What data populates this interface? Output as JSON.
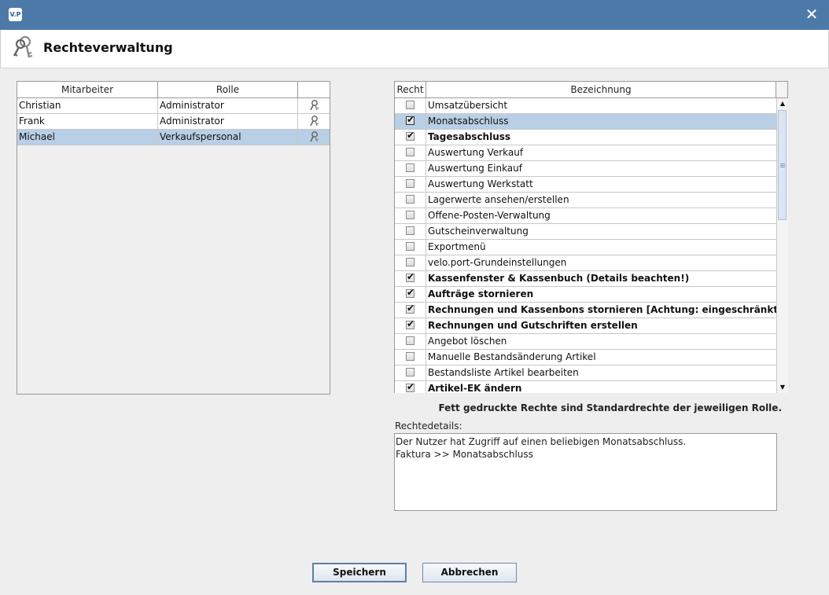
{
  "window": {
    "logo_text": "V.P",
    "close_glyph": "✕",
    "title": "Rechteverwaltung",
    "title_icon": "keys-icon"
  },
  "employees": {
    "columns": [
      "Mitarbeiter",
      "Rolle",
      ""
    ],
    "rows": [
      {
        "name": "Christian",
        "role": "Administrator",
        "action_icon": "edit-role-icon",
        "selected": false
      },
      {
        "name": "Frank",
        "role": "Administrator",
        "action_icon": "edit-role-icon",
        "selected": false
      },
      {
        "name": "Michael",
        "role": "Verkaufspersonal",
        "action_icon": "edit-role-icon",
        "selected": true
      }
    ]
  },
  "rights": {
    "columns": [
      "Recht",
      "Bezeichnung"
    ],
    "check_glyph": "✔",
    "rows": [
      {
        "label": "Umsatzübersicht",
        "checked": false,
        "bold": false,
        "selected": false
      },
      {
        "label": "Monatsabschluss",
        "checked": true,
        "bold": false,
        "selected": true
      },
      {
        "label": "Tagesabschluss",
        "checked": true,
        "bold": true,
        "selected": false
      },
      {
        "label": "Auswertung Verkauf",
        "checked": false,
        "bold": false,
        "selected": false
      },
      {
        "label": "Auswertung Einkauf",
        "checked": false,
        "bold": false,
        "selected": false
      },
      {
        "label": "Auswertung Werkstatt",
        "checked": false,
        "bold": false,
        "selected": false
      },
      {
        "label": "Lagerwerte ansehen/erstellen",
        "checked": false,
        "bold": false,
        "selected": false
      },
      {
        "label": "Offene-Posten-Verwaltung",
        "checked": false,
        "bold": false,
        "selected": false
      },
      {
        "label": "Gutscheinverwaltung",
        "checked": false,
        "bold": false,
        "selected": false
      },
      {
        "label": "Exportmenü",
        "checked": false,
        "bold": false,
        "selected": false
      },
      {
        "label": "velo.port-Grundeinstellungen",
        "checked": false,
        "bold": false,
        "selected": false
      },
      {
        "label": "Kassenfenster & Kassenbuch (Details beachten!)",
        "checked": true,
        "bold": true,
        "selected": false
      },
      {
        "label": "Aufträge stornieren",
        "checked": true,
        "bold": true,
        "selected": false
      },
      {
        "label": "Rechnungen und Kassenbons stornieren [Achtung: eingeschränkt]",
        "checked": true,
        "bold": true,
        "selected": false
      },
      {
        "label": "Rechnungen und Gutschriften erstellen",
        "checked": true,
        "bold": true,
        "selected": false
      },
      {
        "label": "Angebot löschen",
        "checked": false,
        "bold": false,
        "selected": false
      },
      {
        "label": "Manuelle Bestandsänderung Artikel",
        "checked": false,
        "bold": false,
        "selected": false
      },
      {
        "label": "Bestandsliste Artikel bearbeiten",
        "checked": false,
        "bold": false,
        "selected": false
      },
      {
        "label": "Artikel-EK ändern",
        "checked": true,
        "bold": true,
        "selected": false
      }
    ],
    "scrollbar": {
      "up_glyph": "▲",
      "down_glyph": "▼"
    }
  },
  "note": "Fett gedruckte Rechte sind Standardrechte der jeweiligen Rolle.",
  "details": {
    "label": "Rechtedetails:",
    "lines": [
      "Der Nutzer hat Zugriff auf einen beliebigen Monatsabschluss.",
      "Faktura >> Monatsabschluss"
    ]
  },
  "buttons": {
    "save": "Speichern",
    "cancel": "Abbrechen"
  }
}
